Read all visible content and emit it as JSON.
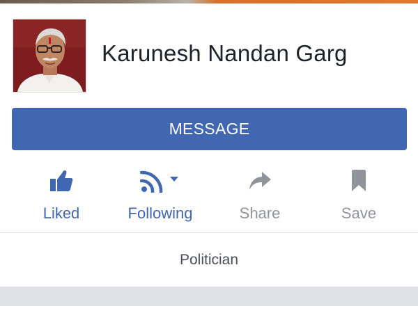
{
  "page": {
    "name": "Karunesh Nandan Garg",
    "category": "Politician"
  },
  "profile_photo": {
    "description_icon": "profile-photo"
  },
  "message_button": {
    "label": "MESSAGE"
  },
  "actions": [
    {
      "label": "Liked",
      "icon": "thumbs-up-icon",
      "state": "active"
    },
    {
      "label": "Following",
      "icon": "rss-feed-icon",
      "state": "active"
    },
    {
      "label": "Share",
      "icon": "share-arrow-icon",
      "state": "inactive"
    },
    {
      "label": "Save",
      "icon": "bookmark-icon",
      "state": "inactive"
    }
  ],
  "colors": {
    "accent": "#4267b2",
    "inactive": "#90949c",
    "text": "#1d2129"
  }
}
